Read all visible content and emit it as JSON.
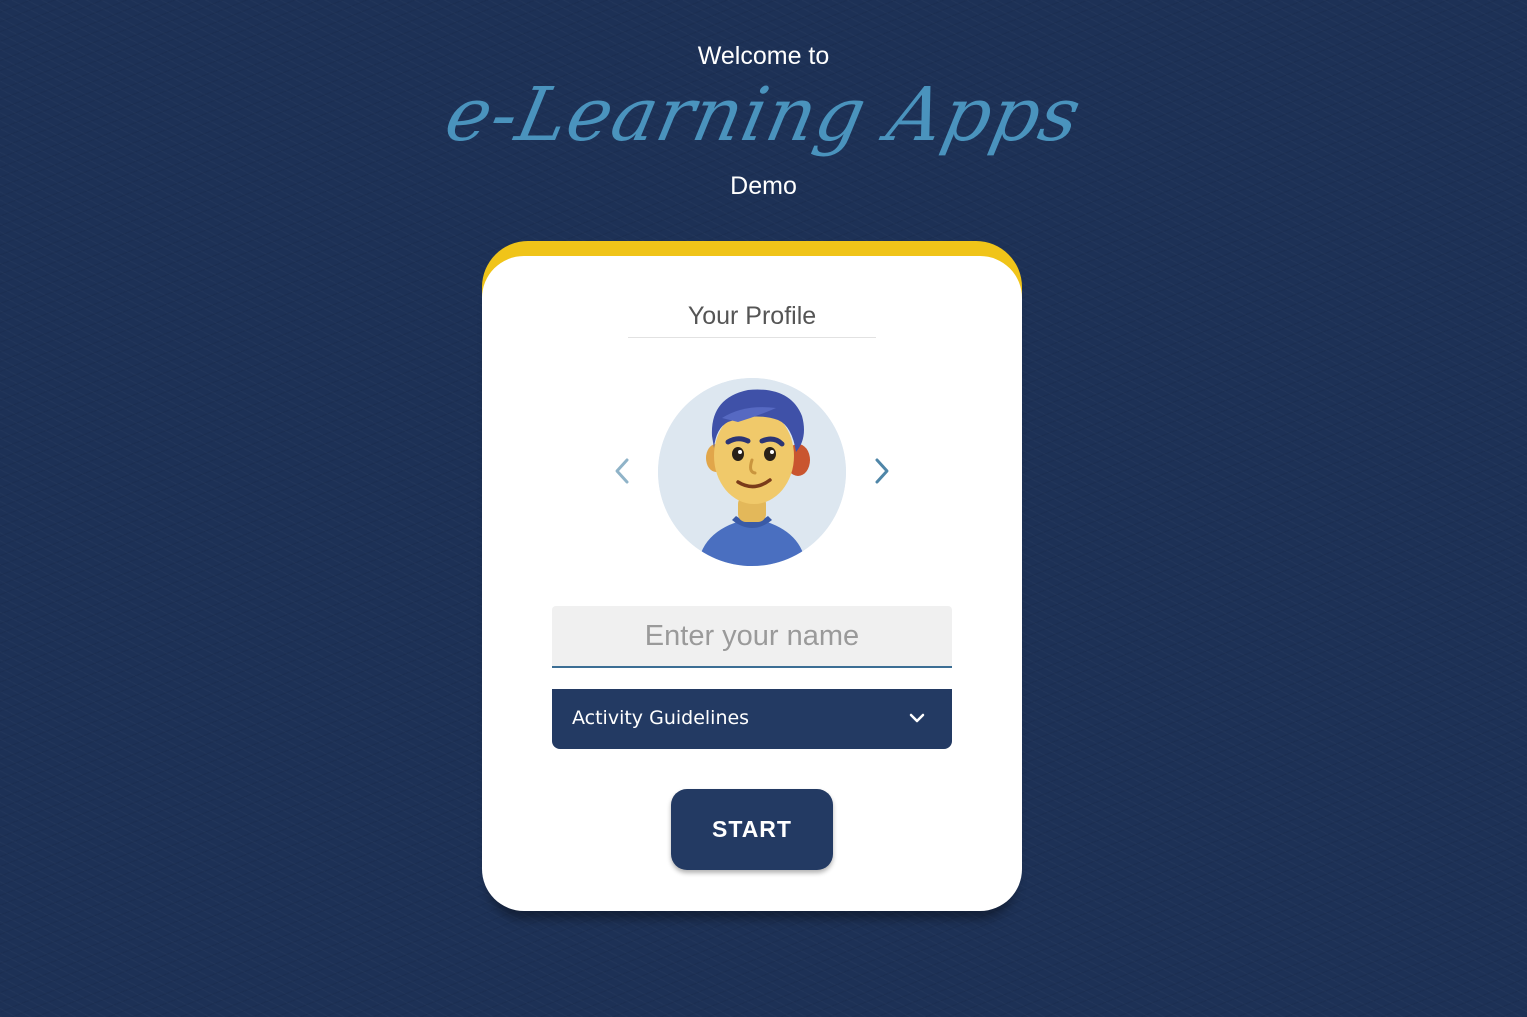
{
  "header": {
    "welcome": "Welcome to",
    "app_name": "e-Learning Apps",
    "subtitle": "Demo"
  },
  "profile": {
    "title": "Your Profile",
    "avatar_icon": "avatar-boy-icon",
    "prev_icon": "chevron-left-icon",
    "next_icon": "chevron-right-icon"
  },
  "name_input": {
    "value": "",
    "placeholder": "Enter your name"
  },
  "guidelines": {
    "label": "Activity Guidelines",
    "icon": "chevron-down-icon"
  },
  "start_button": {
    "label": "START"
  },
  "colors": {
    "background": "#1d3156",
    "brand_blue": "#4a93bd",
    "accent_yellow": "#f0c419",
    "navy": "#233a63"
  }
}
